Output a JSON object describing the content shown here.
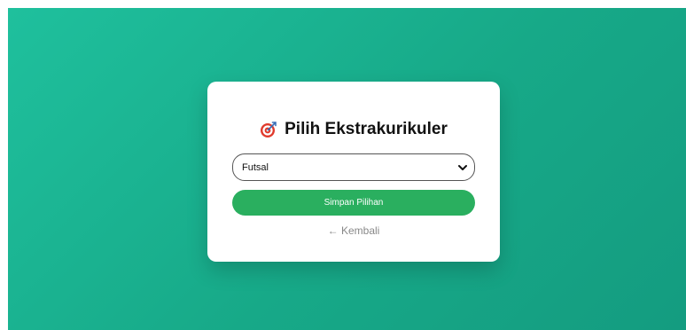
{
  "form": {
    "icon": "target-icon",
    "title": "Pilih Ekstrakurikuler",
    "select_value": "Futsal",
    "submit_label": "Simpan Pilihan",
    "back_label": "← Kembali"
  },
  "colors": {
    "background_start": "#1fc09d",
    "background_end": "#149c80",
    "button": "#2aaf5f",
    "card": "#ffffff"
  }
}
